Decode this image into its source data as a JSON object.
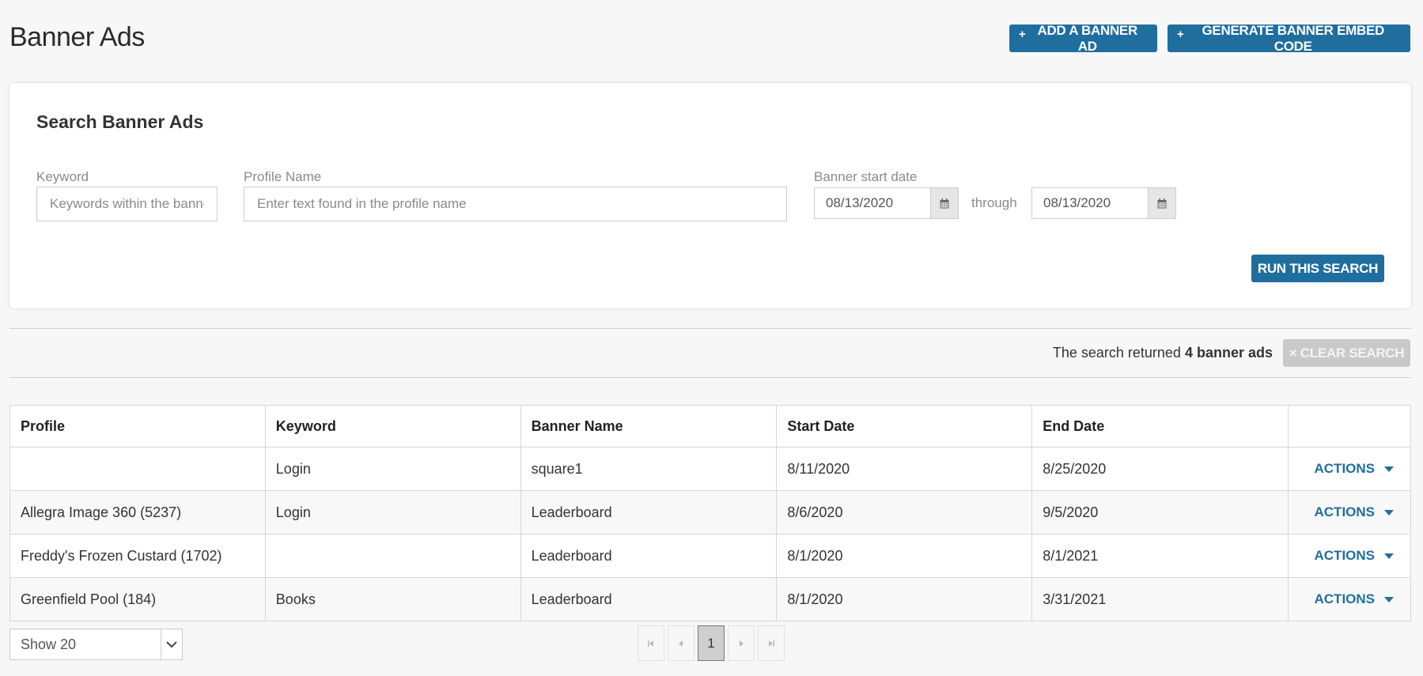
{
  "page": {
    "title": "Banner Ads"
  },
  "header": {
    "add_label": "ADD A BANNER AD",
    "generate_label": "GENERATE BANNER EMBED CODE",
    "plus": "+"
  },
  "search": {
    "title": "Search Banner Ads",
    "keyword_label": "Keyword",
    "keyword_placeholder": "Keywords within the banner",
    "profile_label": "Profile Name",
    "profile_placeholder": "Enter text found in the profile name",
    "start_label": "Banner start date",
    "date_from": "08/13/2020",
    "through": "through",
    "date_to": "08/13/2020",
    "run_label": "RUN THIS SEARCH"
  },
  "results": {
    "prefix": "The search returned ",
    "count_text": "4 banner ads",
    "clear_label": "CLEAR SEARCH",
    "clear_icon": "×"
  },
  "table": {
    "headers": [
      "Profile",
      "Keyword",
      "Banner Name",
      "Start Date",
      "End Date",
      ""
    ],
    "actions_label": "ACTIONS",
    "rows": [
      {
        "profile": "",
        "keyword": "Login",
        "banner": "square1",
        "start": "8/11/2020",
        "end": "8/25/2020"
      },
      {
        "profile": "Allegra Image 360 (5237)",
        "keyword": "Login",
        "banner": "Leaderboard",
        "start": "8/6/2020",
        "end": "9/5/2020"
      },
      {
        "profile": "Freddy's Frozen Custard (1702)",
        "keyword": "",
        "banner": "Leaderboard",
        "start": "8/1/2020",
        "end": "8/1/2021"
      },
      {
        "profile": "Greenfield Pool (184)",
        "keyword": "Books",
        "banner": "Leaderboard",
        "start": "8/1/2020",
        "end": "3/31/2021"
      }
    ]
  },
  "footer": {
    "show_value": "Show 20",
    "current_page": "1"
  },
  "colors": {
    "primary": "#1f6e9e",
    "disabled": "#c9c9c9"
  },
  "icons": {
    "calendar": "calendar-icon",
    "caret": "caret-down-icon",
    "chevron": "chevron-down-icon"
  }
}
